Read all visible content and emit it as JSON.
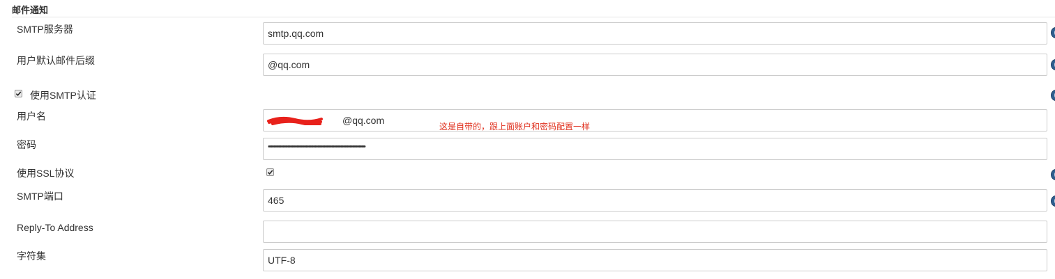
{
  "section": {
    "title": "邮件通知"
  },
  "fields": {
    "smtp_server": {
      "label": "SMTP服务器",
      "value": "smtp.qq.com"
    },
    "default_suffix": {
      "label": "用户默认邮件后缀",
      "value": "@qq.com"
    },
    "use_smtp_auth": {
      "label": "使用SMTP认证",
      "checked": true
    },
    "username": {
      "label": "用户名",
      "visible_suffix": "@qq.com",
      "redacted": true
    },
    "password": {
      "label": "密码",
      "masked": "•••••••••••••••••••••••••••••••••••••••••••••••••••••••••••••••••••••••••••"
    },
    "use_ssl": {
      "label": "使用SSL协议",
      "checked": true
    },
    "smtp_port": {
      "label": "SMTP端口",
      "value": "465"
    },
    "reply_to": {
      "label": "Reply-To Address",
      "value": ""
    },
    "charset": {
      "label": "字符集",
      "value": "UTF-8"
    }
  },
  "annotation": {
    "text": "这是自带的，跟上面账户和密码配置一样",
    "color": "#e0301e"
  },
  "icons": {
    "help": "help-icon",
    "checkmark": "checkmark-icon"
  },
  "colors": {
    "help_icon": "#2f5f8f",
    "border": "#cccccc",
    "redaction": "#e8211b"
  }
}
